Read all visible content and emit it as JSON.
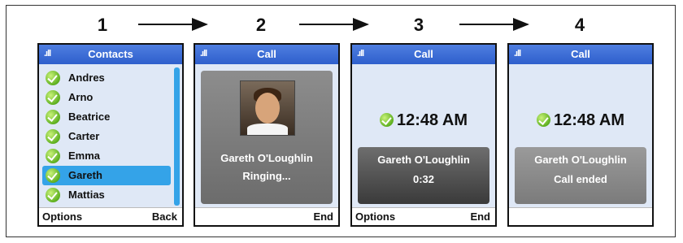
{
  "steps": [
    "1",
    "2",
    "3",
    "4"
  ],
  "screens": [
    {
      "title": "Contacts",
      "signal": ".ıll",
      "contacts": [
        "Andres",
        "Arno",
        "Beatrice",
        "Carter",
        "Emma",
        "Gareth",
        "Mattias"
      ],
      "selected": "Gareth",
      "softkeys": {
        "left": "Options",
        "right": "Back"
      }
    },
    {
      "title": "Call",
      "signal": ".ıll",
      "caller": "Gareth O'Loughlin",
      "status": "Ringing...",
      "softkeys": {
        "left": "",
        "right": "End"
      }
    },
    {
      "title": "Call",
      "signal": ".ıll",
      "time": "12:48 AM",
      "caller": "Gareth O'Loughlin",
      "status": "0:32",
      "softkeys": {
        "left": "Options",
        "right": "End"
      }
    },
    {
      "title": "Call",
      "signal": ".ıll",
      "time": "12:48 AM",
      "caller": "Gareth O'Loughlin",
      "status": "Call ended",
      "softkeys": {
        "left": "",
        "right": ""
      }
    }
  ],
  "colors": {
    "titlebar": "#2e5fcc",
    "selection": "#34a3e8",
    "screen_bg": "#dfe8f6",
    "card": "#7a7a7a",
    "presence": "#5fb020"
  }
}
